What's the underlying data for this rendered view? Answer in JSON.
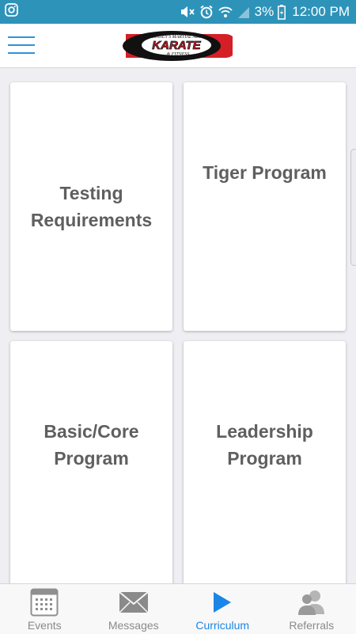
{
  "status_bar": {
    "battery": "3%",
    "time": "12:00 PM",
    "icons": [
      "instagram-icon",
      "mute-icon",
      "alarm-icon",
      "wifi-icon",
      "signal-icon",
      "battery-icon"
    ]
  },
  "header": {
    "menu_icon": "hamburger-menu-icon",
    "logo": {
      "top_text": "CHANEY'S MARTIAL ARTS",
      "main_text": "KARATE",
      "bottom_text": "& FITNESS"
    }
  },
  "cards": [
    {
      "title": "Testing\nRequirements"
    },
    {
      "title": "Tiger Program"
    },
    {
      "title": "Basic/Core\nProgram"
    },
    {
      "title": "Leadership\nProgram"
    }
  ],
  "tabs": [
    {
      "label": "Events",
      "icon": "calendar-icon"
    },
    {
      "label": "Messages",
      "icon": "envelope-icon"
    },
    {
      "label": "Curriculum",
      "icon": "play-icon",
      "active": true
    },
    {
      "label": "Referrals",
      "icon": "people-icon"
    }
  ],
  "colors": {
    "status_bar": "#2e93b9",
    "accent": "#1a86e6",
    "background": "#eeeef3",
    "card_text": "#5f5f5f"
  }
}
